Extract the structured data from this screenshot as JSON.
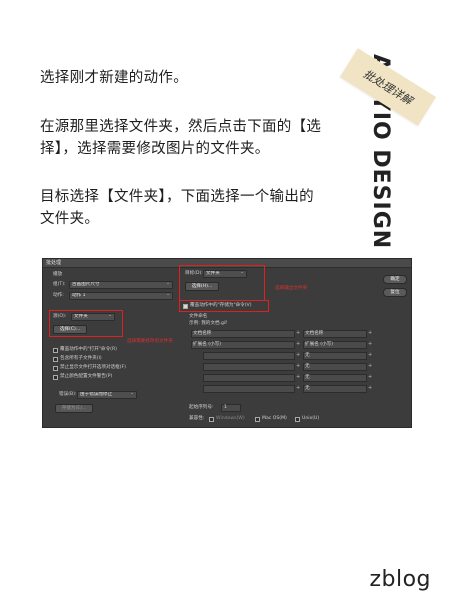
{
  "instructions": {
    "p1": "选择刚才新建的动作。",
    "p2": "在源那里选择文件夹，然后点击下面的【选择】，选择需要修改图片的文件夹。",
    "p3": "目标选择【文件夹】，下面选择一个输出的文件夹。"
  },
  "brand": {
    "text": "AMYIO DESIGN",
    "stamp": "批处理详解"
  },
  "watermark": "zblog",
  "dialog": {
    "title": "批处理",
    "play_label": "播放",
    "group_label": "组(T):",
    "group_value": "古画图片尺寸",
    "action_label": "动作:",
    "action_value": "动作 1",
    "source_label": "源(O):",
    "source_value": "文件夹",
    "choose_button": "选择(C)...",
    "source_options": [
      "覆盖动作中的\"打开\"命令(R)",
      "包含所有子文件夹(I)",
      "禁止显示文件打开选项对话框(F)",
      "禁止颜色配置文件警告(P)"
    ],
    "errors_label": "错误(B):",
    "errors_value": "由于错误而停止",
    "save_as_button": "存储为(E)...",
    "dest_label": "目标(D):",
    "dest_value": "文件夹",
    "dest_choose_button": "选择(H)...",
    "override_save": "覆盖动作中的\"存储为\"命令(V)",
    "naming_header": "文件命名",
    "example_label": "示例: 我的文档.gif",
    "naming_rows": [
      {
        "left": "文档名称",
        "right": "文档名称"
      },
      {
        "left": "扩展名 (小写)",
        "right": "扩展名 (小写)"
      },
      {
        "left": "",
        "right": "无"
      },
      {
        "left": "",
        "right": "无"
      },
      {
        "left": "",
        "right": "无"
      },
      {
        "left": "",
        "right": "无"
      }
    ],
    "serial_label": "起始序列号:",
    "serial_value": "1",
    "compat_label": "兼容性:",
    "compat_options": [
      "Windows(W)",
      "Mac OS(M)",
      "Unix(U)"
    ],
    "ok_button": "确定",
    "reset_button": "复位",
    "note_source": "选择需要修改的文件夹",
    "note_dest": "选择输出文件夹"
  }
}
